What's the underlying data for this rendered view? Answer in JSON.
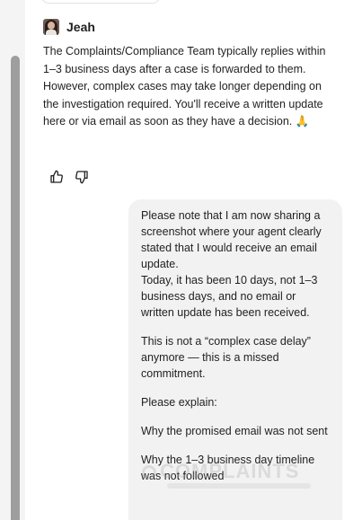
{
  "agent": {
    "name": "Jeah",
    "message": "The Complaints/Compliance Team typically replies within 1–3 business days after a case is forwarded to them. However, complex cases may take longer depending on the investigation required. You'll receive a written update here or via email as soon as they have a decision. 🙏"
  },
  "feedback": {
    "like_icon": "thumbs-up-icon",
    "dislike_icon": "thumbs-down-icon"
  },
  "user_message": {
    "paragraphs": [
      "Please note that I am now sharing a screenshot where your agent clearly stated that I would receive an email update.\nToday, it has been 10 days, not 1–3 business days, and no email or written update has been received.",
      "This is not a “complex case delay” anymore — this is a missed commitment.",
      "Please explain:",
      "Why the promised email was not sent",
      "Why the 1–3 business day timeline was not followed"
    ]
  },
  "watermark": {
    "text": "COMPLAINTS"
  },
  "colors": {
    "bubble": "#f2f2f2",
    "scrollbar": "#9e9e9e",
    "text": "#1f1f1f"
  }
}
